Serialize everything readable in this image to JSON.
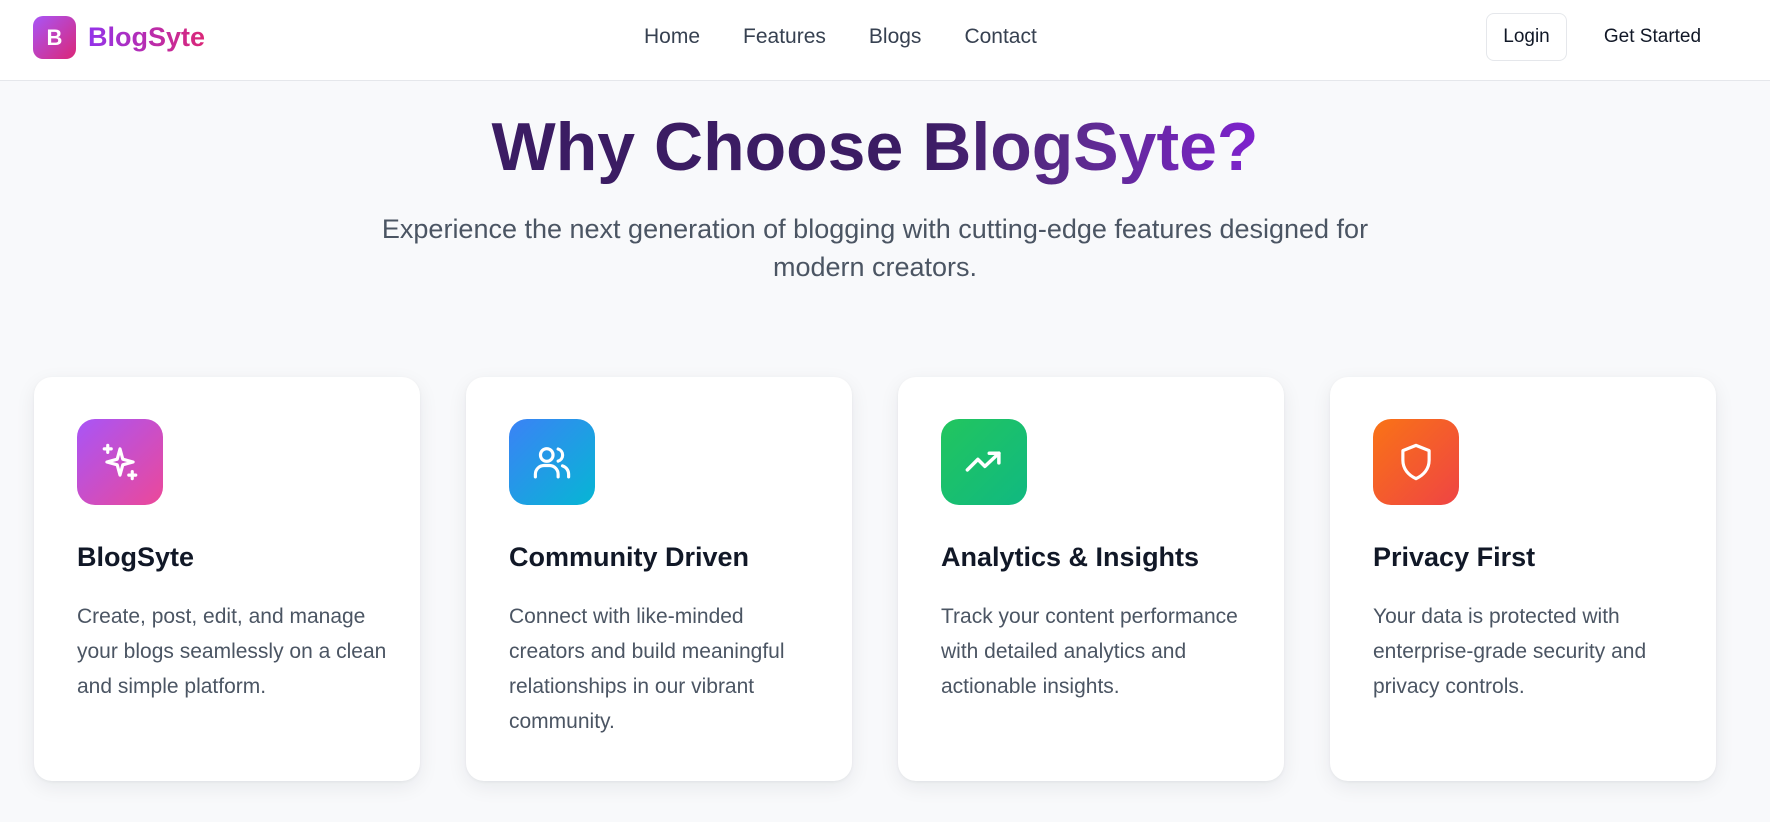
{
  "brand": {
    "logo_letter": "B",
    "name": "BlogSyte"
  },
  "nav": {
    "items": [
      "Home",
      "Features",
      "Blogs",
      "Contact"
    ]
  },
  "actions": {
    "login": "Login",
    "get_started": "Get Started"
  },
  "hero": {
    "title_prefix": "Why Choose ",
    "title_highlight": "BlogSyte?",
    "subtitle": "Experience the next generation of blogging with cutting-edge features designed for modern creators."
  },
  "features": [
    {
      "icon": "sparkles-icon",
      "title": "BlogSyte",
      "description": "Create, post, edit, and manage your blogs seamlessly on a clean and simple platform."
    },
    {
      "icon": "users-icon",
      "title": "Community Driven",
      "description": "Connect with like-minded creators and build meaningful relationships in our vibrant community."
    },
    {
      "icon": "trending-up-icon",
      "title": "Analytics & Insights",
      "description": "Track your content performance with detailed analytics and actionable insights."
    },
    {
      "icon": "shield-icon",
      "title": "Privacy First",
      "description": "Your data is protected with enterprise-grade security and privacy controls."
    }
  ],
  "colors": {
    "brand_gradient": [
      "#a855f7",
      "#db2777"
    ],
    "feature_gradients": [
      [
        "#a855f7",
        "#ec4899"
      ],
      [
        "#3b82f6",
        "#06b6d4"
      ],
      [
        "#22c55e",
        "#10b981"
      ],
      [
        "#f97316",
        "#ef4444"
      ]
    ]
  }
}
